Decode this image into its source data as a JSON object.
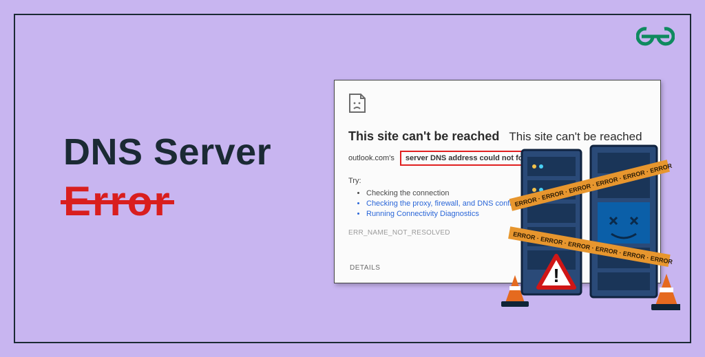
{
  "title": {
    "line1": "DNS Server",
    "line2": "Error"
  },
  "panel": {
    "heading_bold": "This site can't be reached",
    "heading_plain": "This site can't be reached",
    "domain_prefix": "outlook.com's",
    "boxed_msg": "server DNS address could not found.",
    "try_label": "Try:",
    "bullets": [
      "Checking the connection",
      "Checking the proxy, firewall, and DNS configuration",
      "Running Connectivity Diagnostics"
    ],
    "error_code": "ERR_NAME_NOT_RESOLVED",
    "details_label": "DETAILS"
  },
  "illustration": {
    "tape_text": "ERROR",
    "elements": [
      "server-rack",
      "server-rack",
      "warning-sign",
      "traffic-cone",
      "traffic-cone"
    ]
  },
  "brand": "GeeksforGeeks"
}
